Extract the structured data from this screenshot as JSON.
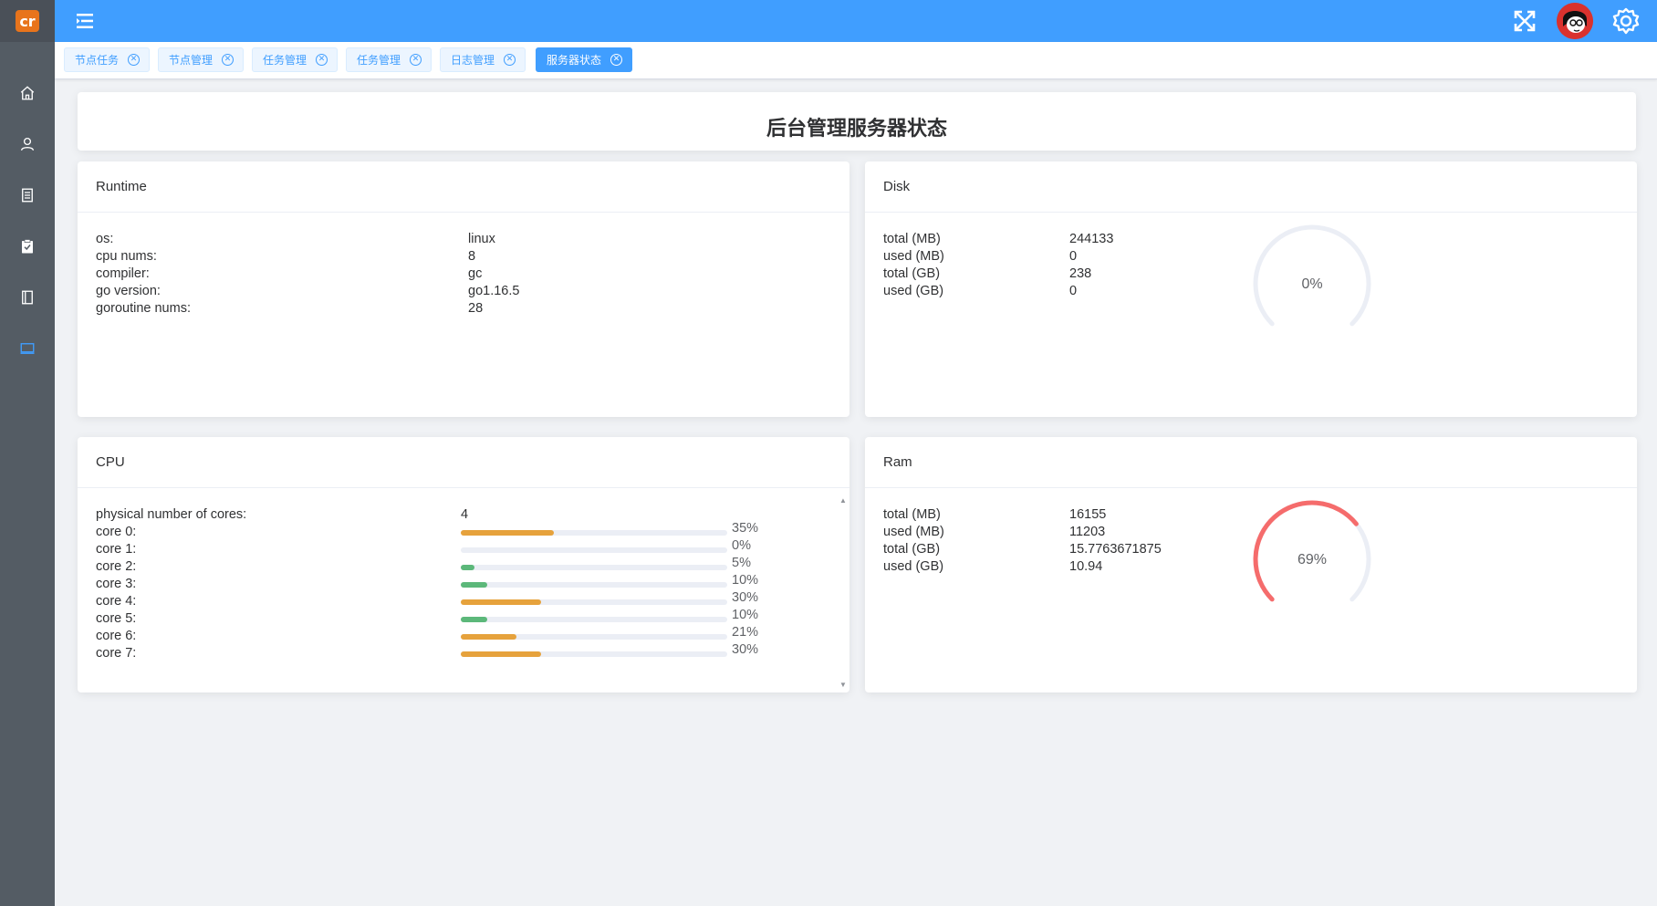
{
  "logo": {
    "text": "cr"
  },
  "sidebar": {
    "items": [
      {
        "icon": "home-icon"
      },
      {
        "icon": "user-icon"
      },
      {
        "icon": "document-icon"
      },
      {
        "icon": "clipboard-check-icon"
      },
      {
        "icon": "notebook-icon"
      },
      {
        "icon": "monitor-icon",
        "active": true
      }
    ],
    "active_color": "#409eff"
  },
  "header": {
    "background": "#409eff",
    "menu_icon": "hamburger-menu-icon",
    "fullscreen_icon": "fullscreen-icon",
    "settings_icon": "gear-icon"
  },
  "tabs": [
    {
      "label": "节点任务"
    },
    {
      "label": "节点管理"
    },
    {
      "label": "任务管理"
    },
    {
      "label": "任务管理"
    },
    {
      "label": "日志管理"
    },
    {
      "label": "服务器状态",
      "active": true
    }
  ],
  "page_title": "后台管理服务器状态",
  "runtime": {
    "title": "Runtime",
    "rows": [
      {
        "key": "os:",
        "value": "linux"
      },
      {
        "key": "cpu nums:",
        "value": "8"
      },
      {
        "key": "compiler:",
        "value": "gc"
      },
      {
        "key": "go version:",
        "value": "go1.16.5"
      },
      {
        "key": "goroutine nums:",
        "value": "28"
      }
    ]
  },
  "disk": {
    "title": "Disk",
    "rows": [
      {
        "key": "total (MB)",
        "value": "244133"
      },
      {
        "key": "used (MB)",
        "value": "0"
      },
      {
        "key": "total (GB)",
        "value": "238"
      },
      {
        "key": "used (GB)",
        "value": "0"
      }
    ],
    "gauge_percent": 0,
    "gauge_label": "0%",
    "gauge_color": "#ebeef5"
  },
  "cpu": {
    "title": "CPU",
    "cores_label": "physical number of cores:",
    "cores_value": "4",
    "cores": [
      {
        "label": "core 0:",
        "percent": 35,
        "text": "35%",
        "color": "#e6a23c"
      },
      {
        "label": "core 1:",
        "percent": 0,
        "text": "0%",
        "color": "#67c23a"
      },
      {
        "label": "core 2:",
        "percent": 5,
        "text": "5%",
        "color": "#5cb87a"
      },
      {
        "label": "core 3:",
        "percent": 10,
        "text": "10%",
        "color": "#5cb87a"
      },
      {
        "label": "core 4:",
        "percent": 30,
        "text": "30%",
        "color": "#e6a23c"
      },
      {
        "label": "core 5:",
        "percent": 10,
        "text": "10%",
        "color": "#5cb87a"
      },
      {
        "label": "core 6:",
        "percent": 21,
        "text": "21%",
        "color": "#e6a23c"
      },
      {
        "label": "core 7:",
        "percent": 30,
        "text": "30%",
        "color": "#e6a23c"
      }
    ]
  },
  "ram": {
    "title": "Ram",
    "rows": [
      {
        "key": "total (MB)",
        "value": "16155"
      },
      {
        "key": "used (MB)",
        "value": "11203"
      },
      {
        "key": "total (GB)",
        "value": "15.7763671875"
      },
      {
        "key": "used (GB)",
        "value": "10.94"
      }
    ],
    "gauge_percent": 69,
    "gauge_label": "69%",
    "gauge_color": "#f56c6c"
  }
}
